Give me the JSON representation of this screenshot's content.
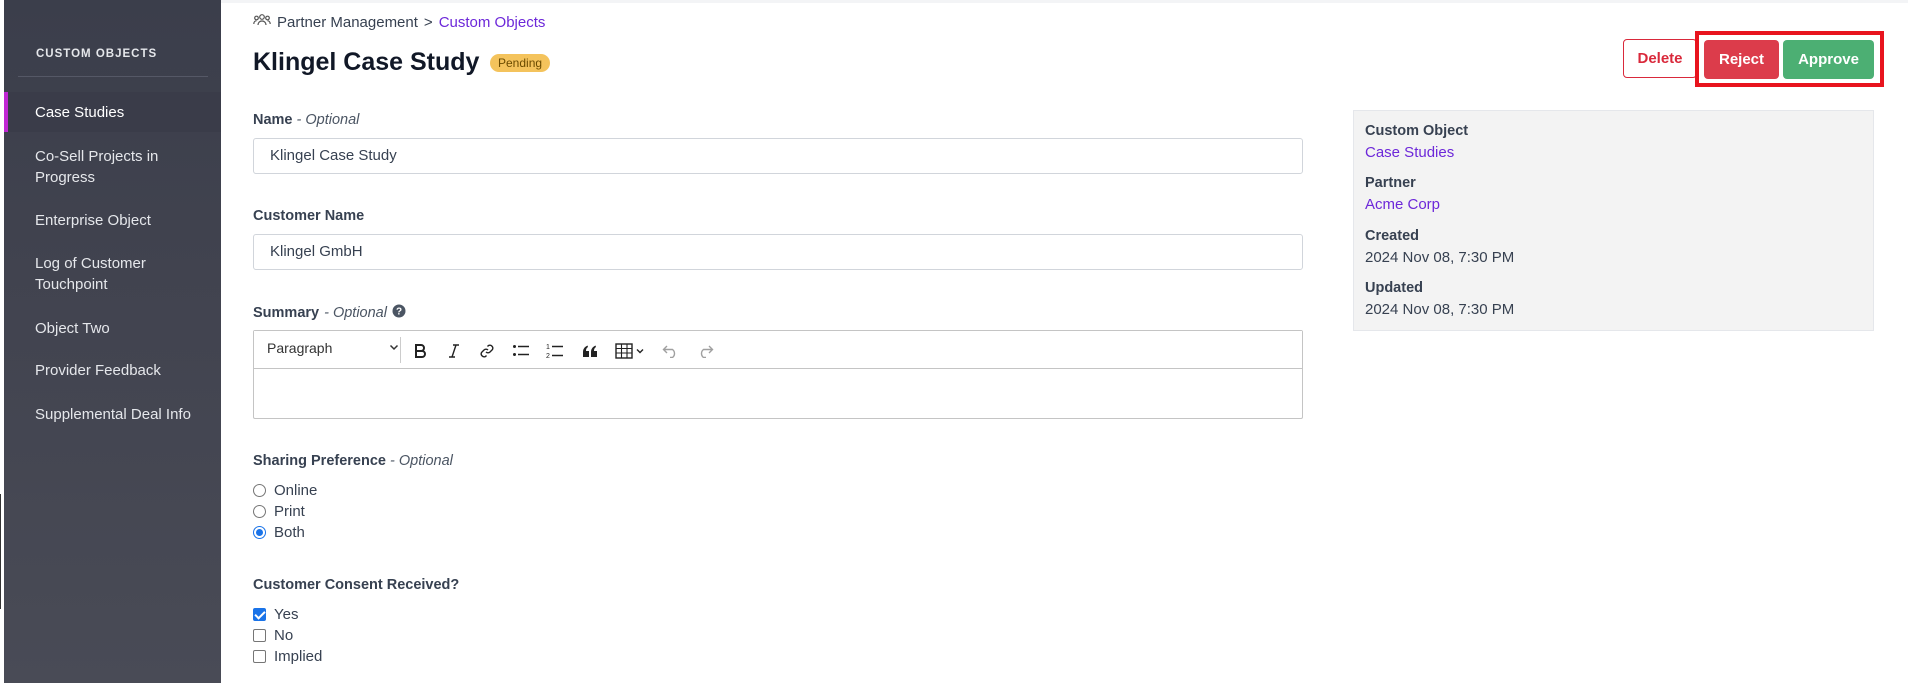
{
  "breadcrumb": {
    "parent": "Partner Management",
    "separator": ">",
    "current": "Custom Objects"
  },
  "page": {
    "title": "Klingel Case Study",
    "status_badge": "Pending"
  },
  "actions": {
    "delete_label": "Delete",
    "reject_label": "Reject",
    "approve_label": "Approve"
  },
  "sidebar": {
    "heading": "CUSTOM OBJECTS",
    "items": [
      {
        "label": "Case Studies",
        "active": true
      },
      {
        "label": "Co-Sell Projects in Progress",
        "active": false
      },
      {
        "label": "Enterprise Object",
        "active": false
      },
      {
        "label": "Log of Customer Touchpoint",
        "active": false
      },
      {
        "label": "Object Two",
        "active": false
      },
      {
        "label": "Provider Feedback",
        "active": false
      },
      {
        "label": "Supplemental Deal Info",
        "active": false
      }
    ]
  },
  "form": {
    "name": {
      "label": "Name",
      "optional": "- Optional",
      "value": "Klingel Case Study"
    },
    "customer_name": {
      "label": "Customer Name",
      "value": "Klingel GmbH"
    },
    "summary": {
      "label": "Summary",
      "optional": "- Optional",
      "help_icon": "question-circle-icon",
      "format_select": "Paragraph",
      "toolbar_icons": [
        "bold-icon",
        "italic-icon",
        "link-icon",
        "bulleted-list-icon",
        "numbered-list-icon",
        "blockquote-icon",
        "table-icon",
        "undo-icon",
        "redo-icon"
      ],
      "value": ""
    },
    "sharing_preference": {
      "label": "Sharing Preference",
      "optional": "- Optional",
      "options": [
        "Online",
        "Print",
        "Both"
      ],
      "selected": "Both"
    },
    "customer_consent": {
      "label": "Customer Consent Received?",
      "options": [
        {
          "label": "Yes",
          "checked": true
        },
        {
          "label": "No",
          "checked": false
        },
        {
          "label": "Implied",
          "checked": false
        }
      ]
    }
  },
  "info_panel": {
    "custom_object_label": "Custom Object",
    "custom_object_value": "Case Studies",
    "partner_label": "Partner",
    "partner_value": "Acme Corp",
    "created_label": "Created",
    "created_value": "2024 Nov 08, 7:30 PM",
    "updated_label": "Updated",
    "updated_value": "2024 Nov 08, 7:30 PM"
  },
  "colors": {
    "sidebar_bg": "#41434f",
    "sidebar_active_accent": "#c026d3",
    "link": "#6d28d9",
    "reject": "#dc3c4b",
    "approve": "#4caf73",
    "delete_outline": "#d9293b",
    "badge": "#f4c35c",
    "highlight": "#e8141e"
  }
}
